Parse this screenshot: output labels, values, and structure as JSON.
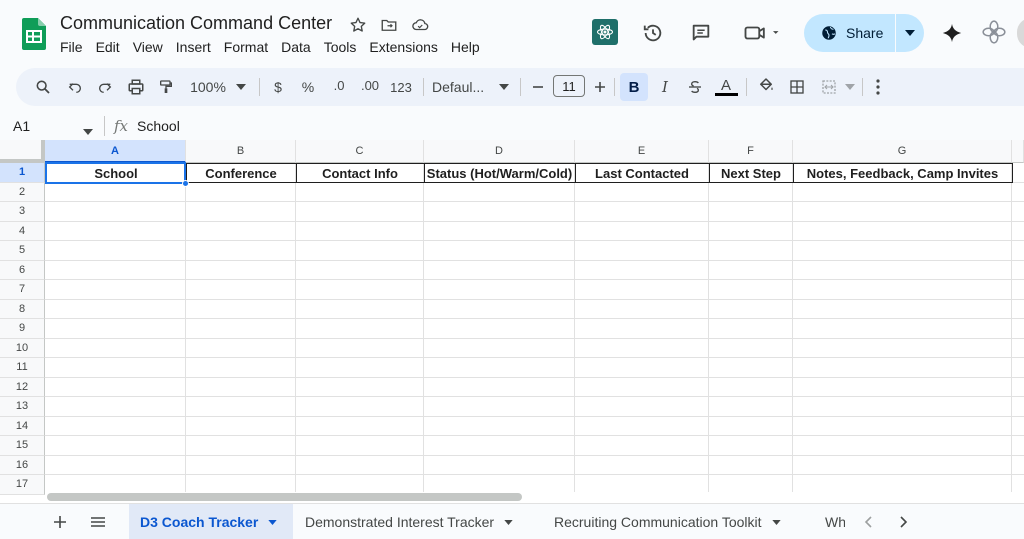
{
  "doc": {
    "title": "Communication Command Center"
  },
  "menu": [
    "File",
    "Edit",
    "View",
    "Insert",
    "Format",
    "Data",
    "Tools",
    "Extensions",
    "Help"
  ],
  "share": {
    "label": "Share"
  },
  "toolbar": {
    "zoom": "100%",
    "currency": "$",
    "percent": "%",
    "dec_decrease": ".0",
    "dec_increase": ".00",
    "number_format": "123",
    "font": "Defaul...",
    "font_size": "11",
    "bold": "B",
    "italic": "I",
    "text_color": "A"
  },
  "formula_bar": {
    "cell_ref": "A1",
    "fx": "fx",
    "value": "School"
  },
  "columns": [
    "A",
    "B",
    "C",
    "D",
    "E",
    "F",
    "G"
  ],
  "rows": [
    "1",
    "2",
    "3",
    "4",
    "5",
    "6",
    "7",
    "8",
    "9",
    "10",
    "11",
    "12",
    "13",
    "14",
    "15",
    "16",
    "17"
  ],
  "header_row": [
    "School",
    "Conference",
    "Contact Info",
    "Status (Hot/Warm/Cold)",
    "Last Contacted",
    "Next Step",
    "Notes, Feedback, Camp Invites"
  ],
  "sheets": [
    {
      "label": "D3 Coach Tracker",
      "active": true
    },
    {
      "label": "Demonstrated Interest Tracker",
      "active": false
    },
    {
      "label": "Recruiting Communication Toolkit",
      "active": false
    },
    {
      "label": "Wh",
      "active": false
    }
  ],
  "colors": {
    "accent": "#1a73e8",
    "share_bg": "#c2e7ff",
    "selected_header": "#d3e3fd",
    "sheets_green": "#0f9d58"
  }
}
